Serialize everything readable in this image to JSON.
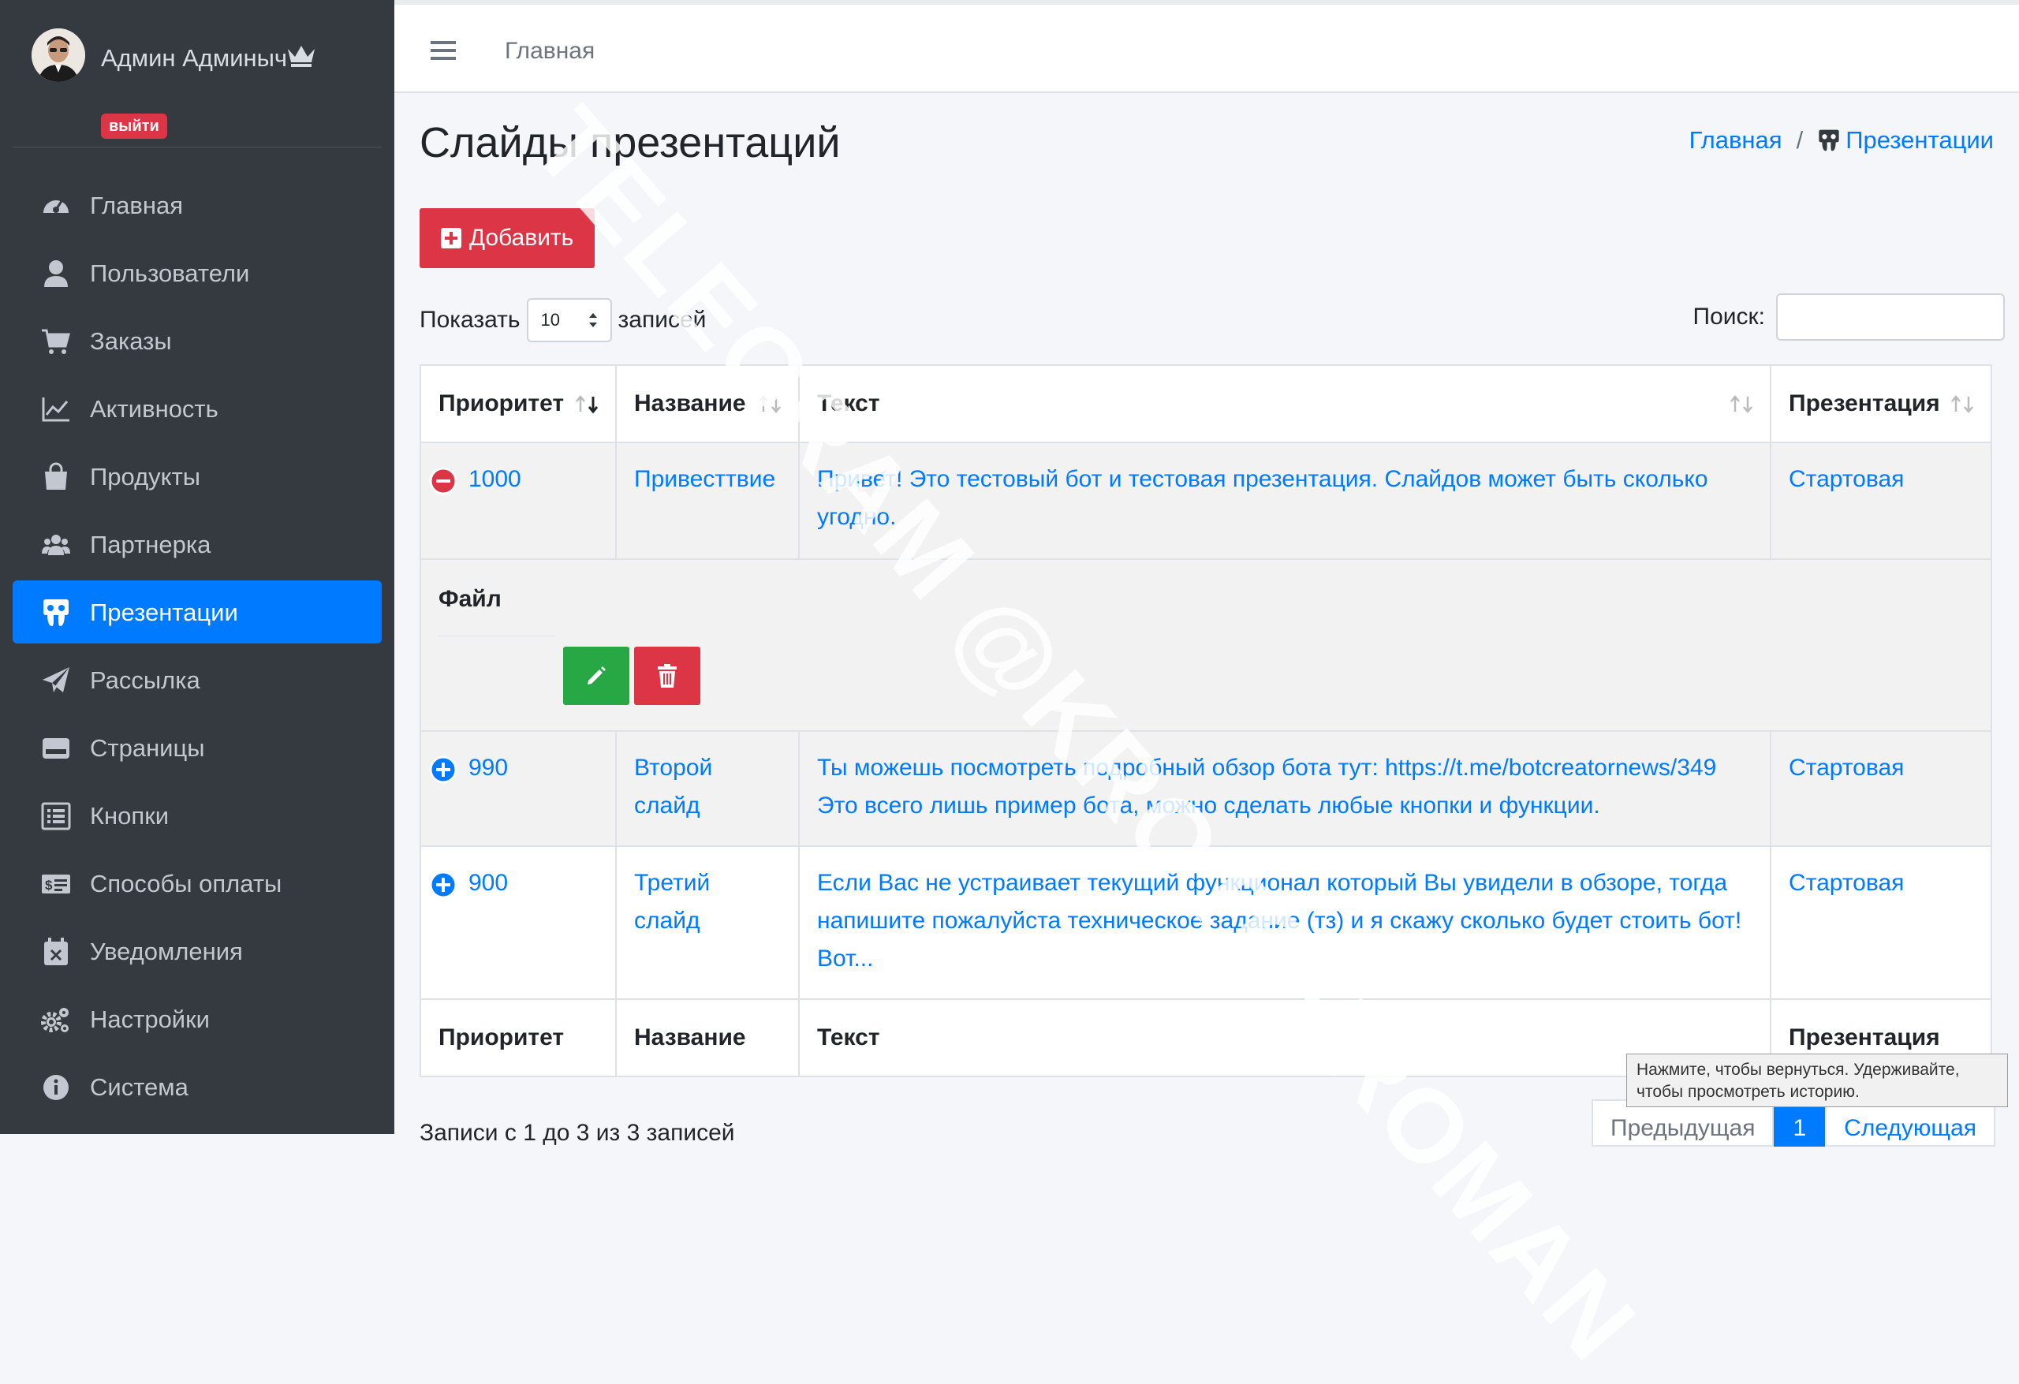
{
  "sidebar": {
    "user_name": "Админ Админыч",
    "logout_label": "выйти",
    "items": [
      {
        "label": "Главная",
        "icon": "dashboard-icon"
      },
      {
        "label": "Пользователи",
        "icon": "user-icon"
      },
      {
        "label": "Заказы",
        "icon": "cart-icon"
      },
      {
        "label": "Активность",
        "icon": "chart-line-icon"
      },
      {
        "label": "Продукты",
        "icon": "shopping-bag-icon"
      },
      {
        "label": "Партнерка",
        "icon": "users-icon"
      },
      {
        "label": "Презентации",
        "icon": "slideshare-icon"
      },
      {
        "label": "Рассылка",
        "icon": "paper-plane-icon"
      },
      {
        "label": "Страницы",
        "icon": "page-icon"
      },
      {
        "label": "Кнопки",
        "icon": "list-icon"
      },
      {
        "label": "Способы оплаты",
        "icon": "money-icon"
      },
      {
        "label": "Уведомления",
        "icon": "calendar-icon"
      },
      {
        "label": "Настройки",
        "icon": "cogs-icon"
      },
      {
        "label": "Система",
        "icon": "info-icon"
      }
    ]
  },
  "topbar": {
    "home_label": "Главная"
  },
  "page": {
    "title": "Слайды презентаций",
    "breadcrumb": {
      "home": "Главная",
      "sep": "/",
      "current": "Презентации"
    },
    "add_label": "Добавить"
  },
  "length_control": {
    "prefix": "Показать",
    "value": "10",
    "suffix": "записей"
  },
  "search": {
    "label": "Поиск:"
  },
  "table": {
    "headers": [
      "Приоритет",
      "Название",
      "Текст",
      "Презентация"
    ],
    "rows": [
      {
        "priority": "1000",
        "name": "Привесттвие",
        "text": "Привет! Это тестовый бот и тестовая презентация. Слайдов может быть сколько угодно.",
        "presentation": "Стартовая",
        "expanded": true
      },
      {
        "priority": "990",
        "name": "Второй слайд",
        "text": "Ты можешь посмотреть подробный обзор бота тут: https://t.me/botcreatornews/349 Это всего лишь пример бота, можно сделать любые кнопки и функции.",
        "presentation": "Стартовая",
        "expanded": false
      },
      {
        "priority": "900",
        "name": "Третий слайд",
        "text": "Если Вас не устраивает текущий функционал который Вы увидели в обзоре, тогда напишите пожалуйста техническое задание (тз) и я скажу сколько будет стоить бот! Вот...",
        "presentation": "Стартовая",
        "expanded": false
      }
    ],
    "child": {
      "label": "Файл"
    }
  },
  "tooltip": {
    "line1": "Нажмите, чтобы вернуться. Удерживайте,",
    "line2": "чтобы просмотреть историю."
  },
  "pagination": {
    "prev": "Предыдущая",
    "current": "1",
    "next": "Следующая"
  },
  "info": "Записи с 1 до 3 из 3 записей",
  "watermark": "TELEGRAM @KROTOVROMAN",
  "colors": {
    "sidebar": "#343a40",
    "active": "#007bff",
    "danger": "#dc3545",
    "success": "#28a745"
  }
}
